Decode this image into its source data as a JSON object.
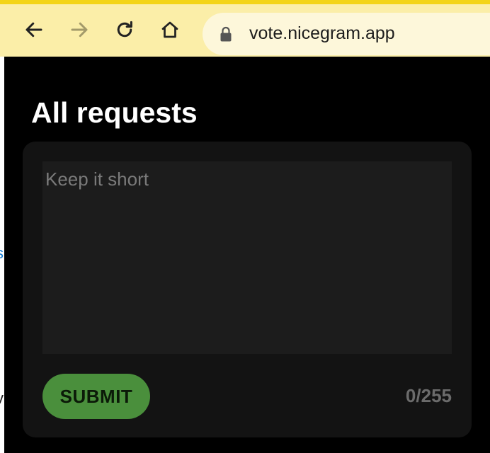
{
  "browser": {
    "url": "vote.nicegram.app",
    "back_icon": "arrow-left-icon",
    "forward_icon": "arrow-right-icon",
    "reload_icon": "reload-icon",
    "home_icon": "home-icon",
    "lock_icon": "lock-icon",
    "accent_color": "#f3d417",
    "toolbar_color": "#fbeea8"
  },
  "page": {
    "title": "All requests",
    "form": {
      "placeholder": "Keep it short",
      "value": "",
      "submit_label": "SUBMIT",
      "counter": "0/255"
    },
    "submit_color": "#4a8f3c"
  }
}
